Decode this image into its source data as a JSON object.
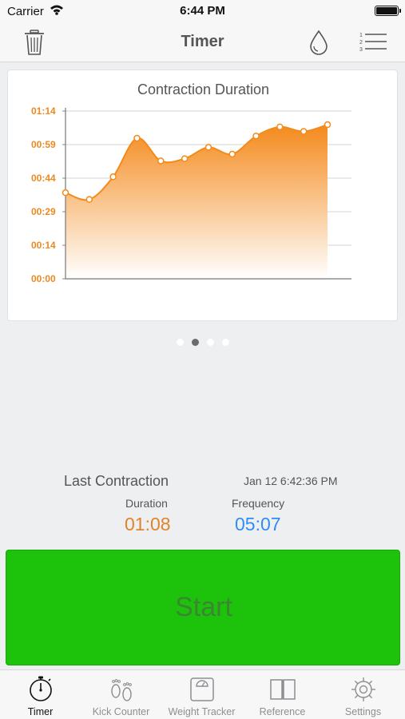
{
  "status_bar": {
    "carrier": "Carrier",
    "time": "6:44 PM",
    "battery_level": 1.0
  },
  "nav": {
    "title": "Timer",
    "icons": [
      "trash-icon",
      "drop-icon",
      "numbered-list-icon"
    ]
  },
  "chart_data": {
    "type": "area",
    "title": "Contraction Duration",
    "xlabel": "",
    "ylabel": "",
    "y_tick_labels": [
      "00:00",
      "00:14",
      "00:29",
      "00:44",
      "00:59",
      "01:14"
    ],
    "ylim_seconds": [
      0,
      74
    ],
    "x": [
      1,
      2,
      3,
      4,
      5,
      6,
      7,
      8,
      9,
      10,
      11,
      12
    ],
    "y_seconds": [
      38,
      35,
      45,
      62,
      52,
      53,
      58,
      55,
      63,
      67,
      65,
      68
    ],
    "grid": true,
    "colors": {
      "line": "#f38b1b",
      "tick_labels": "#ec8a22",
      "fill_top": "#f48a1c",
      "fill_bottom": "#ffffff"
    }
  },
  "pager": {
    "count": 4,
    "active_index": 1
  },
  "last_contraction": {
    "label": "Last Contraction",
    "timestamp": "Jan 12 6:42:36 PM",
    "duration_label": "Duration",
    "duration_value": "01:08",
    "frequency_label": "Frequency",
    "frequency_value": "05:07"
  },
  "start_button": {
    "label": "Start",
    "color": "#1dc30a"
  },
  "tabs": [
    {
      "label": "Timer",
      "icon": "stopwatch-icon",
      "active": true
    },
    {
      "label": "Kick Counter",
      "icon": "footprints-icon",
      "active": false
    },
    {
      "label": "Weight Tracker",
      "icon": "scale-icon",
      "active": false
    },
    {
      "label": "Reference",
      "icon": "book-icon",
      "active": false
    },
    {
      "label": "Settings",
      "icon": "gear-icon",
      "active": false
    }
  ]
}
